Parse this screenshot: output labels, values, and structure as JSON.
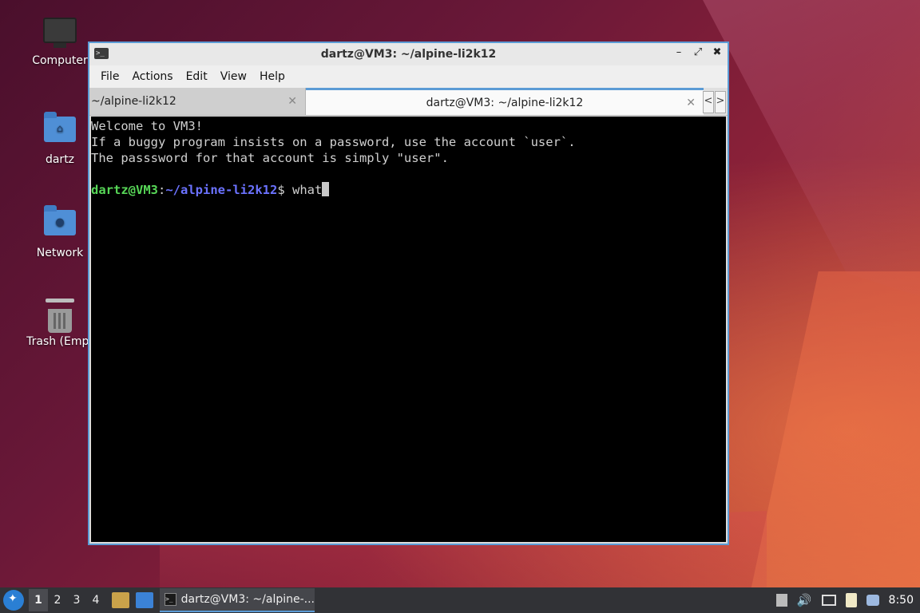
{
  "desktop": {
    "icons": [
      {
        "label": "Computer"
      },
      {
        "label": "dartz"
      },
      {
        "label": "Network"
      },
      {
        "label": "Trash (Empt"
      }
    ]
  },
  "window": {
    "title": "dartz@VM3: ~/alpine-li2k12",
    "controls": {
      "minimize": "–",
      "maximize": "⤢",
      "close": "✖"
    },
    "menu": [
      "File",
      "Actions",
      "Edit",
      "View",
      "Help"
    ],
    "tabs": [
      {
        "label": "~/alpine-li2k12",
        "active": false
      },
      {
        "label": "dartz@VM3: ~/alpine-li2k12",
        "active": true
      }
    ],
    "tab_scroll": {
      "left": "<",
      "right": ">"
    }
  },
  "terminal": {
    "lines": [
      "Welcome to VM3!",
      "If a buggy program insists on a password, use the account `user`.",
      "The passsword for that account is simply \"user\"."
    ],
    "prompt_user": "dartz@VM3",
    "prompt_sep": ":",
    "prompt_path": "~/alpine-li2k12",
    "prompt_symbol": "$ ",
    "input": "what"
  },
  "taskbar": {
    "workspaces": [
      "1",
      "2",
      "3",
      "4"
    ],
    "active_workspace": "1",
    "task_label": "dartz@VM3: ~/alpine-...",
    "clock": "8:50"
  },
  "colors": {
    "accent": "#5b9bd5",
    "prompt_user": "#57d657",
    "prompt_path": "#6b72ff"
  }
}
